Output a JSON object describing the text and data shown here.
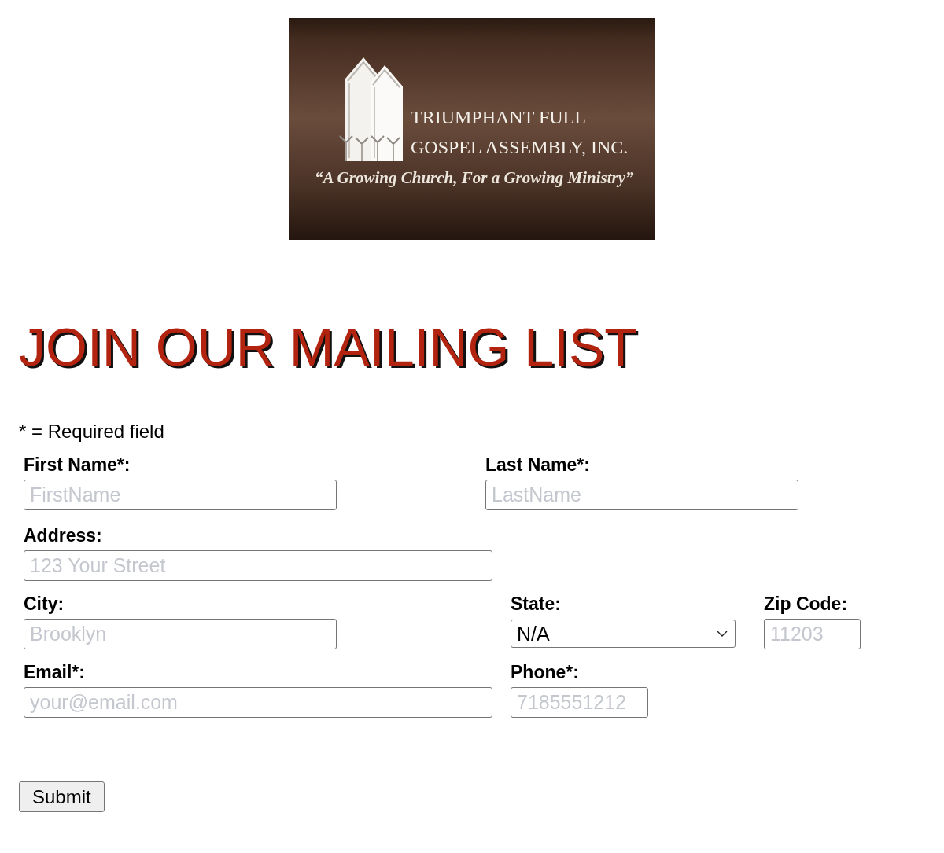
{
  "logo": {
    "name_lines": [
      "TRIUMPHANT FULL",
      "GOSPEL ASSEMBLY, INC."
    ],
    "tagline": "“A Growing Church, For a Growing Ministry”"
  },
  "heading": "JOIN OUR MAILING LIST",
  "required_note": "* = Required field",
  "form_rows": [
    {
      "fields": [
        {
          "kind": "text",
          "label": "First Name*:",
          "placeholder": "FirstName"
        },
        {
          "kind": "text",
          "label": "Last Name*:",
          "placeholder": "LastName"
        }
      ]
    },
    {
      "fields": [
        {
          "kind": "text",
          "label": "Address:",
          "placeholder": "123 Your Street"
        }
      ]
    },
    {
      "fields": [
        {
          "kind": "text",
          "label": "City:",
          "placeholder": "Brooklyn"
        },
        {
          "kind": "select",
          "label": "State:",
          "value": "N/A"
        },
        {
          "kind": "text",
          "label": "Zip Code:",
          "placeholder": "11203"
        }
      ]
    },
    {
      "fields": [
        {
          "kind": "text",
          "label": "Email*:",
          "placeholder": "your@email.com"
        },
        {
          "kind": "text",
          "label": "Phone*:",
          "placeholder": "7185551212"
        }
      ]
    }
  ],
  "submit_button": "Submit"
}
